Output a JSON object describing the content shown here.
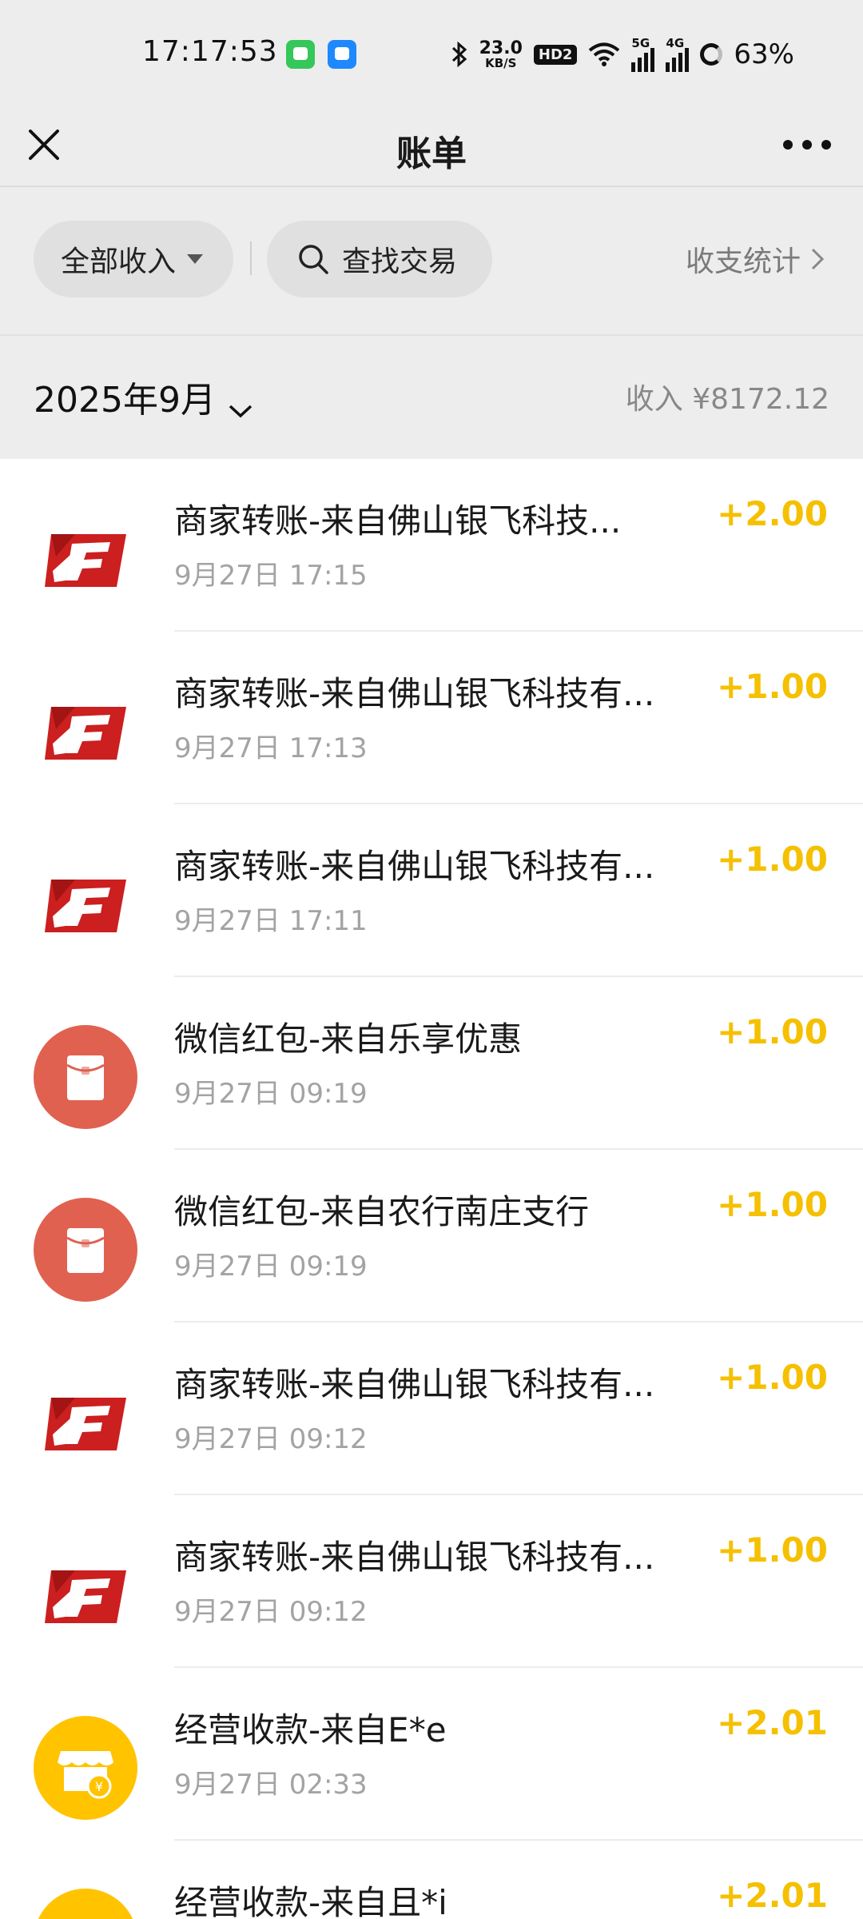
{
  "status_bar": {
    "time": "17:17:53",
    "net_speed_value": "23.0",
    "net_speed_unit": "KB/S",
    "hd_label": "HD2",
    "sim1_tag": "5G",
    "sim2_tag": "4G",
    "battery": "63%"
  },
  "nav": {
    "title": "账单"
  },
  "filters": {
    "category": "全部收入",
    "search_label": "查找交易",
    "stats_label": "收支统计"
  },
  "month": {
    "label": "2025年9月",
    "income_summary": "收入 ¥8172.12"
  },
  "colors": {
    "amount": "#f5c000",
    "merchant_icon": "#cc1f1f",
    "redpacket_icon": "#e06150",
    "business_icon": "#ffc300"
  },
  "transactions": [
    {
      "title": "商家转账-来自佛山银飞科技...",
      "time": "9月27日 17:15",
      "amount": "+2.00",
      "icon": "merchant-f-icon"
    },
    {
      "title": "商家转账-来自佛山银飞科技有...",
      "time": "9月27日 17:13",
      "amount": "+1.00",
      "icon": "merchant-f-icon"
    },
    {
      "title": "商家转账-来自佛山银飞科技有...",
      "time": "9月27日 17:11",
      "amount": "+1.00",
      "icon": "merchant-f-icon"
    },
    {
      "title": "微信红包-来自乐享优惠",
      "time": "9月27日 09:19",
      "amount": "+1.00",
      "icon": "red-packet-icon"
    },
    {
      "title": "微信红包-来自农行南庄支行",
      "time": "9月27日 09:19",
      "amount": "+1.00",
      "icon": "red-packet-icon"
    },
    {
      "title": "商家转账-来自佛山银飞科技有...",
      "time": "9月27日 09:12",
      "amount": "+1.00",
      "icon": "merchant-f-icon"
    },
    {
      "title": "商家转账-来自佛山银飞科技有...",
      "time": "9月27日 09:12",
      "amount": "+1.00",
      "icon": "merchant-f-icon"
    },
    {
      "title": "经营收款-来自E*e",
      "time": "9月27日 02:33",
      "amount": "+2.01",
      "icon": "business-income-icon"
    },
    {
      "title": "经营收款-来自且*i",
      "time": "",
      "amount": "+2.01",
      "icon": "business-income-icon"
    }
  ]
}
